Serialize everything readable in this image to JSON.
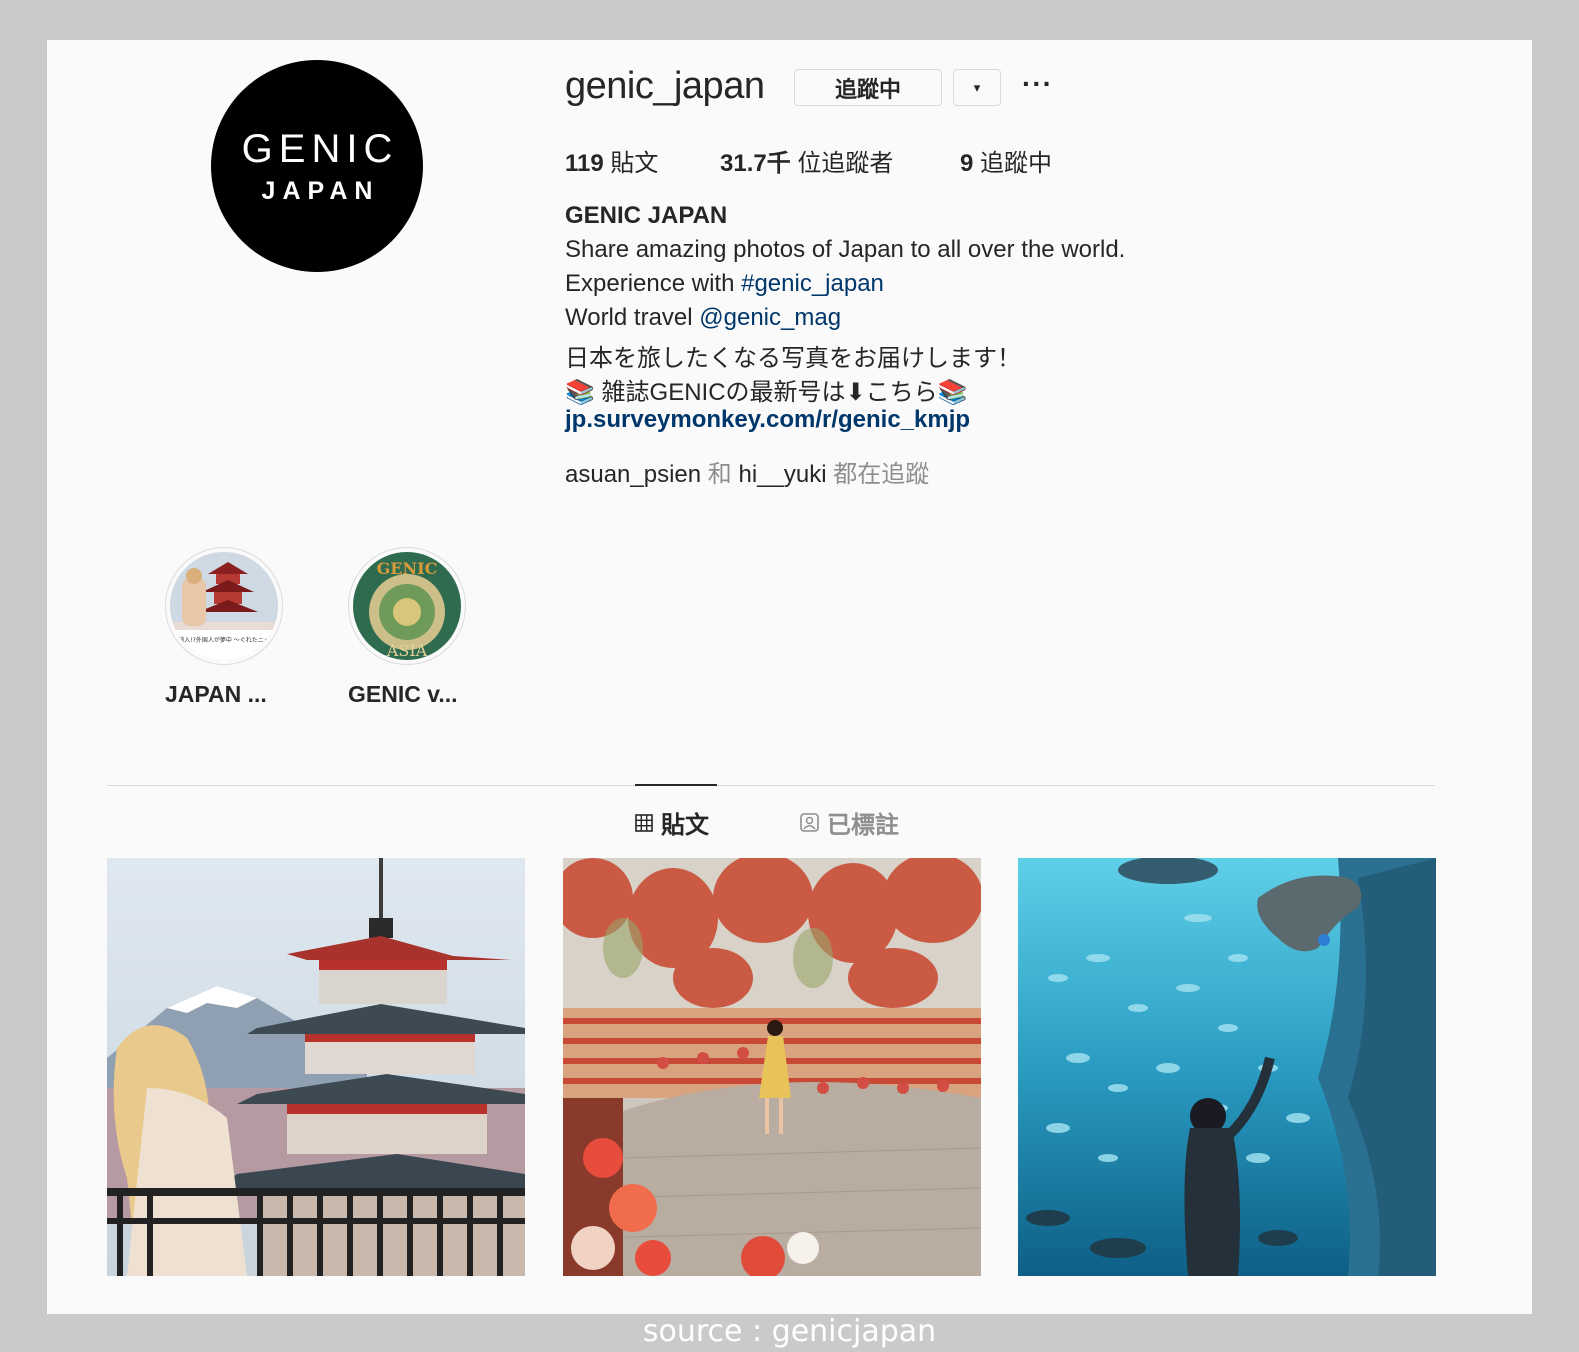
{
  "profile": {
    "avatar_line1": "GENIC",
    "avatar_line2": "JAPAN",
    "username": "genic_japan",
    "follow_button_label": "追蹤中",
    "dropdown_glyph": "▾",
    "more_glyph": "···",
    "stats": {
      "posts_count": "119",
      "posts_label": "貼文",
      "followers_count": "31.7千",
      "followers_label": "位追蹤者",
      "following_count": "9",
      "following_label": "追蹤中"
    },
    "full_name": "GENIC JAPAN",
    "bio": {
      "line1": "Share amazing photos of Japan to all over the world.",
      "line2_text": "Experience with ",
      "line2_hashtag": "#genic_japan",
      "line3_text": "World travel ",
      "line3_mention": "@genic_mag",
      "line4": "日本を旅したくなる写真をお届けします！",
      "line5": "📚 雑誌GENICの最新号は⬇こちら📚",
      "website": "jp.surveymonkey.com/r/genic_kmjp"
    },
    "followed_by": {
      "user1": "asuan_psien",
      "conj": "和",
      "user2": "hi__yuki",
      "suffix": "都在追蹤"
    }
  },
  "highlights": [
    {
      "label": "JAPAN ...",
      "thumb_text": "まさかの逆輸入!?外国人が夢中 〜ぐれたニッポンのペ〜"
    },
    {
      "label": "GENIC v...",
      "thumb_text_top": "GENIC",
      "thumb_text_bottom": "ASIA"
    }
  ],
  "tabs": {
    "posts": "貼文",
    "tagged": "已標註"
  },
  "posts": [
    {
      "subject": "pagoda with Mt. Fuji"
    },
    {
      "subject": "flower garden"
    },
    {
      "subject": "aquarium with stingray"
    }
  ],
  "source_caption": "source : genicjapan",
  "colors": {
    "link": "#00376b",
    "secondary_text": "#8e8e8e",
    "border": "#dbdbdb",
    "panel_bg": "#fafafa",
    "outer_bg": "#cacaca"
  }
}
